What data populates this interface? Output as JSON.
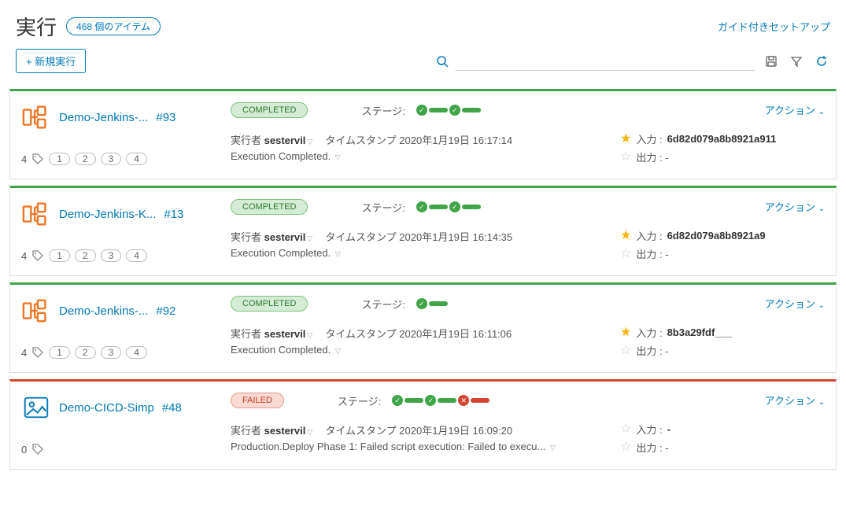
{
  "header": {
    "title": "実行",
    "item_count": "468 個のアイテム",
    "guided_setup": "ガイド付きセットアップ"
  },
  "toolbar": {
    "new_exec": "+ 新規実行",
    "search_placeholder": ""
  },
  "labels": {
    "stage": "ステージ:",
    "executor": "実行者",
    "timestamp": "タイムスタンプ",
    "actions": "アクション",
    "input": "入力 :",
    "output": "出力 :"
  },
  "executions": [
    {
      "name": "Demo-Jenkins-...",
      "num": "#93",
      "icon_type": "pipeline",
      "status": "COMPLETED",
      "status_class": "completed",
      "tag_count": "4",
      "tags": [
        "1",
        "2",
        "3",
        "4"
      ],
      "executor": "sestervil",
      "timestamp": "2020年1月19日 16:17:14",
      "description": "Execution Completed.",
      "input_starred": true,
      "input": "6d82d079a8b8921a911",
      "output": "-",
      "stages": [
        "check-green",
        "bar-green",
        "check-green",
        "bar-green"
      ]
    },
    {
      "name": "Demo-Jenkins-K...",
      "num": "#13",
      "icon_type": "pipeline",
      "status": "COMPLETED",
      "status_class": "completed",
      "tag_count": "4",
      "tags": [
        "1",
        "2",
        "3",
        "4"
      ],
      "executor": "sestervil",
      "timestamp": "2020年1月19日 16:14:35",
      "description": "Execution Completed.",
      "input_starred": true,
      "input": "6d82d079a8b8921a9",
      "output": "-",
      "stages": [
        "check-green",
        "bar-green",
        "check-green",
        "bar-green"
      ]
    },
    {
      "name": "Demo-Jenkins-...",
      "num": "#92",
      "icon_type": "pipeline",
      "status": "COMPLETED",
      "status_class": "completed",
      "tag_count": "4",
      "tags": [
        "1",
        "2",
        "3",
        "4"
      ],
      "executor": "sestervil",
      "timestamp": "2020年1月19日 16:11:06",
      "description": "Execution Completed.",
      "input_starred": true,
      "input": "8b3a29fdf___",
      "output": "-",
      "stages": [
        "check-green",
        "bar-green"
      ]
    },
    {
      "name": "Demo-CICD-Simp",
      "num": "#48",
      "icon_type": "image",
      "status": "FAILED",
      "status_class": "failed",
      "tag_count": "0",
      "tags": [],
      "executor": "sestervil",
      "timestamp": "2020年1月19日 16:09:20",
      "description": "Production.Deploy Phase 1: Failed script execution: Failed to execu...",
      "input_starred": false,
      "input": "-",
      "output": "-",
      "stages": [
        "check-green",
        "bar-green",
        "check-green",
        "bar-green",
        "x-red",
        "bar-red"
      ]
    }
  ]
}
